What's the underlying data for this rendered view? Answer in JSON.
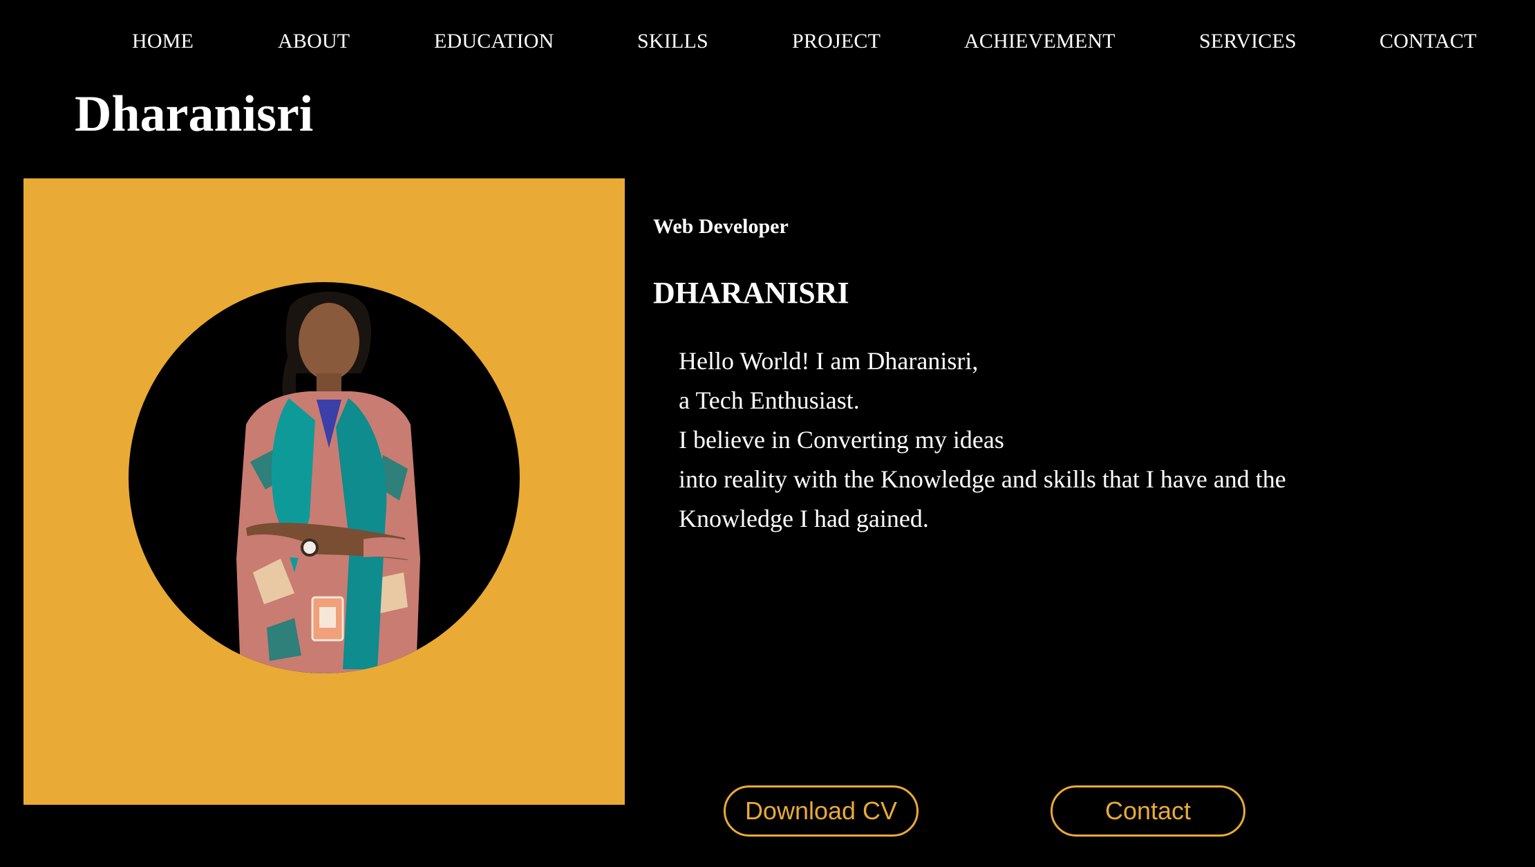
{
  "nav": {
    "items": [
      {
        "label": "HOME"
      },
      {
        "label": "ABOUT"
      },
      {
        "label": "EDUCATION"
      },
      {
        "label": "SKILLS"
      },
      {
        "label": "PROJECT"
      },
      {
        "label": "ACHIEVEMENT"
      },
      {
        "label": "SERVICES"
      },
      {
        "label": "CONTACT"
      }
    ]
  },
  "brand": {
    "name": "Dharanisri"
  },
  "hero": {
    "role": "Web Developer",
    "name": "DHARANISRI",
    "intro_lines": [
      "Hello World! I am Dharanisri,",
      "a Tech Enthusiast.",
      "I believe in Converting my ideas",
      "into reality with the Knowledge and skills that I have and the",
      "Knowledge I had gained."
    ],
    "download_label": "Download CV",
    "contact_label": "Contact"
  },
  "colors": {
    "background": "#000000",
    "accent": "#e9ab35",
    "text": "#ffffff"
  }
}
